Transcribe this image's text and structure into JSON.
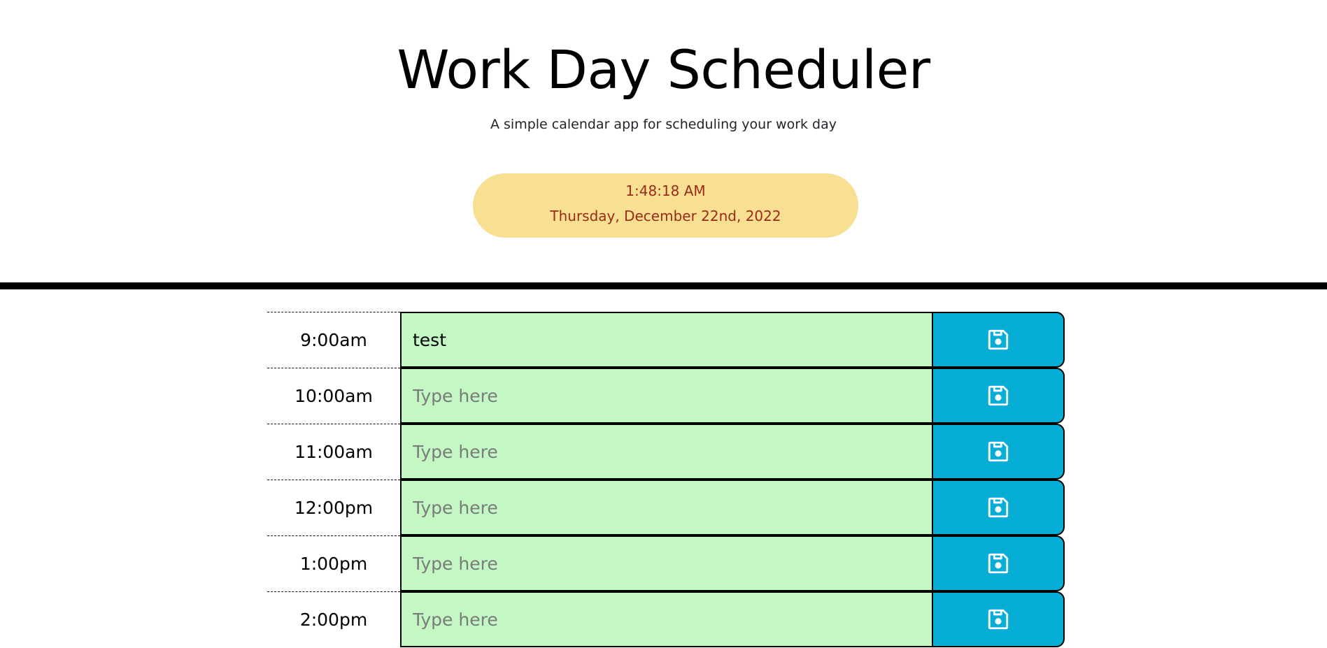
{
  "header": {
    "title": "Work Day Scheduler",
    "subtitle": "A simple calendar app for scheduling your work day"
  },
  "clock": {
    "time": "1:48:18 AM",
    "date": "Thursday, December 22nd, 2022"
  },
  "schedule": {
    "rows": [
      {
        "hour": "9:00am",
        "value": "test",
        "placeholder": "Type here"
      },
      {
        "hour": "10:00am",
        "value": "",
        "placeholder": "Type here"
      },
      {
        "hour": "11:00am",
        "value": "",
        "placeholder": "Type here"
      },
      {
        "hour": "12:00pm",
        "value": "",
        "placeholder": "Type here"
      },
      {
        "hour": "1:00pm",
        "value": "",
        "placeholder": "Type here"
      },
      {
        "hour": "2:00pm",
        "value": "",
        "placeholder": "Type here"
      }
    ]
  },
  "icons": {
    "save": "floppy-disk-icon"
  },
  "colors": {
    "clock_background": "#f8e093",
    "clock_text": "#9b2a18",
    "future_row": "#c3f7c4",
    "save_button": "#06aed5",
    "divider": "#000000"
  }
}
